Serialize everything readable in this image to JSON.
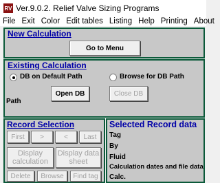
{
  "titlebar": {
    "title": "Ver.9.0.2.  Relief Valve Sizing Programs"
  },
  "menu": [
    "File",
    "Exit",
    "Color",
    "Edit tables",
    "Listing",
    "Help",
    "Printing",
    "About"
  ],
  "new_calc": {
    "title": "New Calculation",
    "goto_menu": "Go to Menu"
  },
  "existing": {
    "title": "Existing Calculation",
    "radio_default": "DB on Default Path",
    "radio_default_selected": true,
    "radio_browse": "Browse for DB Path",
    "open_db": "Open DB",
    "close_db": "Close DB",
    "path_label": "Path"
  },
  "record_selection": {
    "title": "Record Selection",
    "first": "First",
    "next": ">",
    "prev": "<",
    "last": "Last",
    "display_calc": "Display calculation",
    "display_sheet": "Display data sheet",
    "delete": "Delete",
    "browse": "Browse",
    "find_tag": "Find tag"
  },
  "selected_record": {
    "title": "Selected Record data",
    "tag": "Tag",
    "by": "By",
    "fluid": "Fluid",
    "dates": "Calculation dates and file data",
    "calc": "Calc."
  }
}
